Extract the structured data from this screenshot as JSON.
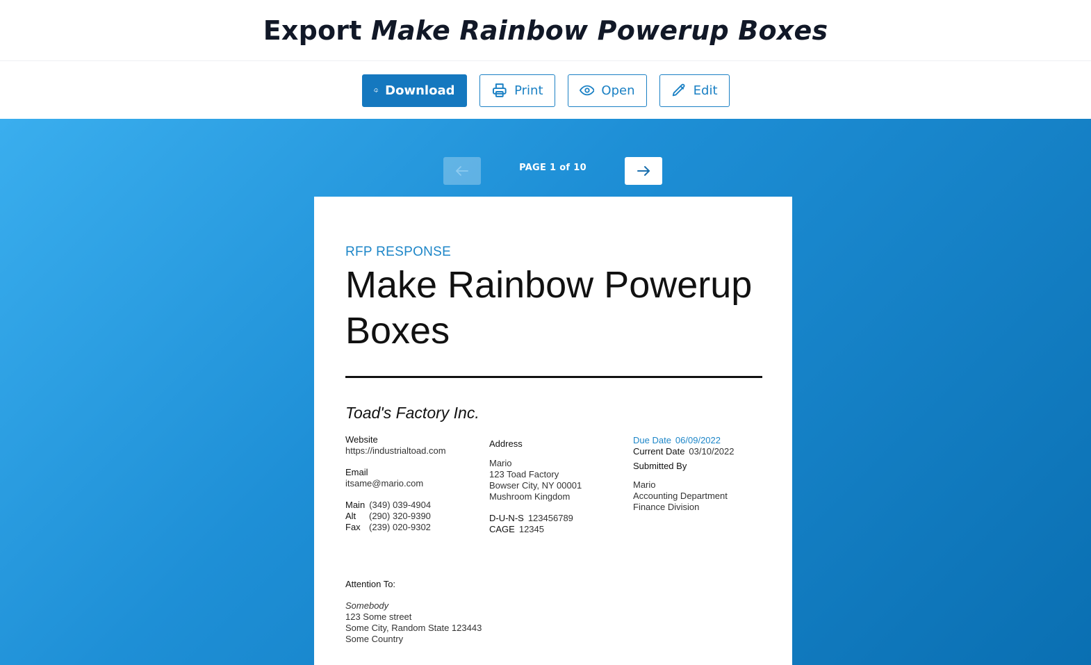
{
  "header": {
    "title_prefix": "Export",
    "title_doc": "Make Rainbow Powerup Boxes"
  },
  "toolbar": {
    "download_label": "Download",
    "print_label": "Print",
    "open_label": "Open",
    "edit_label": "Edit",
    "accent_color": "#1578bf"
  },
  "pager": {
    "label": "PAGE 1 of 10",
    "current_page": 1,
    "total_pages": 10
  },
  "document": {
    "kicker": "RFP RESPONSE",
    "title": "Make Rainbow Powerup Boxes",
    "company": "Toad's Factory Inc.",
    "contact": {
      "website_label": "Website",
      "website": "https://industrialtoad.com",
      "email_label": "Email",
      "email": "itsame@mario.com",
      "main_label": "Main",
      "main": "(349) 039-4904",
      "alt_label": "Alt",
      "alt": "(290) 320-9390",
      "fax_label": "Fax",
      "fax": "(239) 020-9302"
    },
    "address": {
      "label": "Address",
      "line1": "Mario",
      "line2": "123 Toad Factory",
      "line3": "Bowser City, NY 00001",
      "line4": "Mushroom Kingdom",
      "duns_label": "D-U-N-S",
      "duns": "123456789",
      "cage_label": "CAGE",
      "cage": "12345"
    },
    "dates": {
      "due_label": "Due Date",
      "due": "06/09/2022",
      "current_label": "Current Date",
      "current": "03/10/2022",
      "submitted_label": "Submitted By",
      "submitted_line1": "Mario",
      "submitted_line2": "Accounting Department",
      "submitted_line3": "Finance Division"
    },
    "attention": {
      "label": "Attention To:",
      "name": "Somebody",
      "line1": "123 Some street",
      "line2": "Some City, Random State 123443",
      "line3": "Some Country"
    }
  }
}
